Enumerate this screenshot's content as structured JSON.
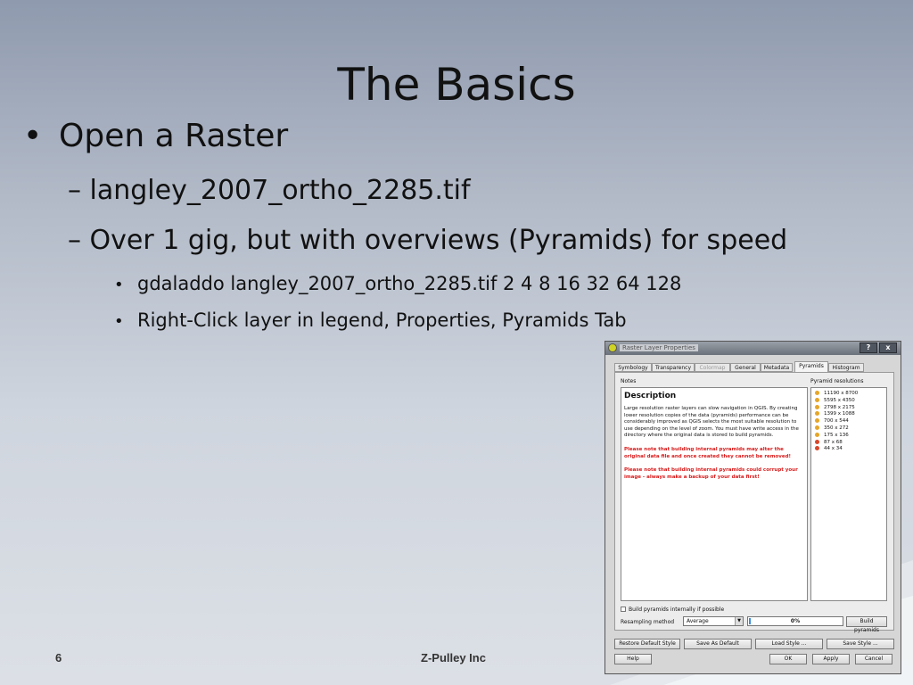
{
  "slide": {
    "title": "The Basics",
    "bullets": [
      {
        "level": 1,
        "text": "Open a Raster"
      },
      {
        "level": 2,
        "text": "– langley_2007_ortho_2285.tif"
      },
      {
        "level": 2,
        "text": "– Over 1 gig, but with overviews (Pyramids) for speed"
      },
      {
        "level": 3,
        "text": "gdaladdo langley_2007_ortho_2285.tif 2 4 8 16 32 64 128"
      },
      {
        "level": 3,
        "text": "Right-Click layer in legend, Properties, Pyramids Tab"
      }
    ],
    "bullet_glyph": "•",
    "page_number": "6",
    "footer": "Z-Pulley Inc"
  },
  "dialog": {
    "title": "Raster Layer Properties",
    "help_btn": "?",
    "close_btn": "x",
    "tabs": [
      {
        "label": "Symbology",
        "state": "normal"
      },
      {
        "label": "Transparency",
        "state": "normal"
      },
      {
        "label": "Colormap",
        "state": "disabled"
      },
      {
        "label": "General",
        "state": "normal"
      },
      {
        "label": "Metadata",
        "state": "normal"
      },
      {
        "label": "Pyramids",
        "state": "active"
      },
      {
        "label": "Histogram",
        "state": "normal"
      }
    ],
    "notes_label": "Notes",
    "pyramid_label": "Pyramid resolutions",
    "description_title": "Description",
    "description_text": "Large resolution raster layers can slow navigation in QGIS. By creating lower resolution copies of the data (pyramids) performance can be considerably improved as QGIS selects the most suitable resolution to use depending on the level of zoom. You must have write access in the directory where the original data is stored to build pyramids.",
    "warning1": "Please note that building internal pyramids may alter the original data file and once created they cannot be removed!",
    "warning2": "Please note that building internal pyramids could corrupt your image - always make a backup of your data first!",
    "resolutions": [
      {
        "label": "11190 x 8700",
        "built": true
      },
      {
        "label": "5595 x 4350",
        "built": true
      },
      {
        "label": "2798 x 2175",
        "built": true
      },
      {
        "label": "1399 x 1088",
        "built": true
      },
      {
        "label": "700 x 544",
        "built": true
      },
      {
        "label": "350 x 272",
        "built": true
      },
      {
        "label": "175 x 136",
        "built": true
      },
      {
        "label": "87 x 68",
        "built": false
      },
      {
        "label": "44 x 34",
        "built": false
      }
    ],
    "build_internal_label": "Build pyramids internally if possible",
    "resampling_label": "Resampling method",
    "resampling_value": "Average",
    "progress_text": "0%",
    "progress_value": 0.02,
    "build_button": "Build pyramids",
    "restore_button": "Restore Default Style",
    "save_default_button": "Save As Default",
    "load_style_button": "Load Style ...",
    "save_style_button": "Save Style ...",
    "help_button": "Help",
    "ok_button": "OK",
    "apply_button": "Apply",
    "cancel_button": "Cancel",
    "colors": {
      "built": "#e6a628",
      "unbuilt": "#d9472b",
      "warning": "#d81b1b",
      "progress": "#3c8ddb"
    }
  }
}
